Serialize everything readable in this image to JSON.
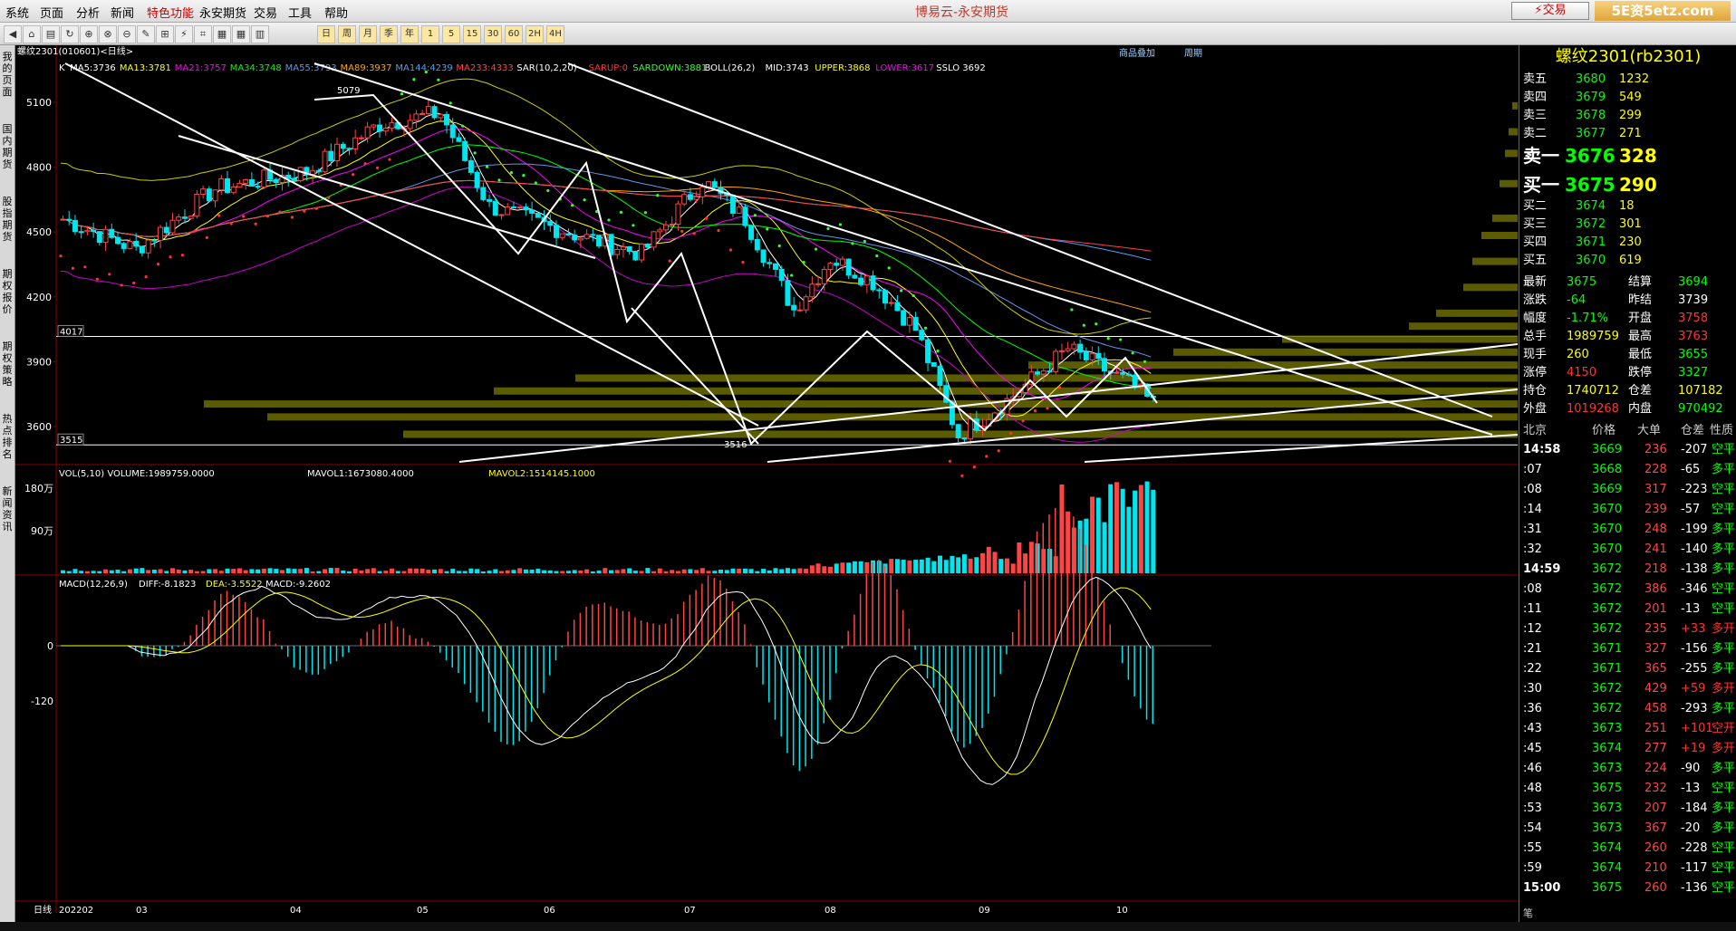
{
  "menu": {
    "items": [
      "系统",
      "页面",
      "分析",
      "新闻",
      "特色功能",
      "永安期货",
      "交易",
      "工具",
      "帮助"
    ],
    "title": "博易云-永安期货",
    "trade": "交易",
    "logo": "5E资5etz.com"
  },
  "toolbar": {
    "buttons": [
      "日",
      "周",
      "月",
      "季",
      "年",
      "1",
      "5",
      "15",
      "30",
      "60",
      "2H",
      "4H"
    ]
  },
  "sidebar": {
    "tabs": [
      "我的页面",
      "国内期货",
      "股指期货",
      "期权报价",
      "期权策略",
      "热点排名",
      "新闻资讯"
    ]
  },
  "chart": {
    "header": "螺纹2301(010601)<日线>",
    "top_links": [
      "商品叠加",
      "周期"
    ],
    "indicators": [
      {
        "t": "K",
        "c": "#ffffff"
      },
      {
        "t": "MA5:3736",
        "c": "#ffffff"
      },
      {
        "t": "MA13:3781",
        "c": "#ffff00"
      },
      {
        "t": "MA21:3757",
        "c": "#ff00ff"
      },
      {
        "t": "MA34:3748",
        "c": "#00ff00"
      },
      {
        "t": "MA55:3793",
        "c": "#6495ed"
      },
      {
        "t": "MA89:3937",
        "c": "#ffa500"
      },
      {
        "t": "MA144:4239",
        "c": "#4f9ef8"
      },
      {
        "t": "MA233:4333",
        "c": "#ff4444"
      },
      {
        "t": "SAR(10,2,20)",
        "c": "#ffffff"
      },
      {
        "t": "SARUP:0",
        "c": "#ff3333"
      },
      {
        "t": "SARDOWN:3881",
        "c": "#33ff33"
      },
      {
        "t": "BOLL(26,2)",
        "c": "#ffffff"
      },
      {
        "t": "MID:3743",
        "c": "#ffffff"
      },
      {
        "t": "UPPER:3868",
        "c": "#ffff00"
      },
      {
        "t": "LOWER:3617",
        "c": "#ff00ff"
      },
      {
        "t": "SSLO 3692",
        "c": "#ffffff"
      }
    ],
    "price_axis": [
      {
        "v": 5100,
        "label": "5100"
      },
      {
        "v": 4800,
        "label": "4800"
      },
      {
        "v": 4500,
        "label": "4500"
      },
      {
        "v": 4200,
        "label": "4200"
      },
      {
        "v": 3900,
        "label": "3900"
      },
      {
        "v": 3600,
        "label": "3600"
      }
    ],
    "hlines": [
      {
        "v": 4017,
        "label": "4017"
      },
      {
        "v": 3515,
        "label": "3515"
      }
    ],
    "peak_label": "5079",
    "low_label": "3516",
    "vol_header": {
      "a": "VOL(5,10) VOLUME:1989759.0000",
      "b": "MAVOL1:1673080.4000",
      "c": "MAVOL2:1514145.1000"
    },
    "vol_axis": [
      "180万",
      "90万"
    ],
    "macd_header": {
      "a": "MACD(12,26,9)",
      "b": "DIFF:-8.1823",
      "c": "DEA:-3.5522",
      "d": "MACD:-9.2602"
    },
    "macd_axis": [
      "0",
      "-120"
    ],
    "date_axis": [
      "日线",
      "202202",
      "03",
      "04",
      "05",
      "06",
      "07",
      "08",
      "09",
      "10"
    ]
  },
  "quote": {
    "title": "螺纹2301(rb2301)",
    "asks": [
      {
        "l": "卖五",
        "p": "3680",
        "v": "1232"
      },
      {
        "l": "卖四",
        "p": "3679",
        "v": "549"
      },
      {
        "l": "卖三",
        "p": "3678",
        "v": "299"
      },
      {
        "l": "卖二",
        "p": "3677",
        "v": "271"
      },
      {
        "l": "卖一",
        "p": "3676",
        "v": "328"
      }
    ],
    "bids": [
      {
        "l": "买一",
        "p": "3675",
        "v": "290"
      },
      {
        "l": "买二",
        "p": "3674",
        "v": "18"
      },
      {
        "l": "买三",
        "p": "3672",
        "v": "301"
      },
      {
        "l": "买四",
        "p": "3671",
        "v": "230"
      },
      {
        "l": "买五",
        "p": "3670",
        "v": "619"
      }
    ],
    "stats": [
      {
        "a": "最新",
        "av": "3675",
        "ac": "#00ff00",
        "b": "结算",
        "bv": "3694",
        "bc": "#00ff00"
      },
      {
        "a": "涨跌",
        "av": "-64",
        "ac": "#00ff00",
        "b": "昨结",
        "bv": "3739",
        "bc": "#ffffff"
      },
      {
        "a": "幅度",
        "av": "-1.71%",
        "ac": "#00ff00",
        "b": "开盘",
        "bv": "3758",
        "bc": "#ff3333"
      },
      {
        "a": "总手",
        "av": "1989759",
        "ac": "#ffff00",
        "b": "最高",
        "bv": "3763",
        "bc": "#ff3333"
      },
      {
        "a": "现手",
        "av": "260",
        "ac": "#ffff00",
        "b": "最低",
        "bv": "3655",
        "bc": "#00ff00"
      },
      {
        "a": "涨停",
        "av": "4150",
        "ac": "#ff3333",
        "b": "跌停",
        "bv": "3327",
        "bc": "#00ff00"
      },
      {
        "a": "持仓",
        "av": "1740712",
        "ac": "#ffff00",
        "b": "仓差",
        "bv": "107182",
        "bc": "#ffff00"
      },
      {
        "a": "外盘",
        "av": "1019268",
        "ac": "#ff3333",
        "b": "内盘",
        "bv": "970492",
        "bc": "#00ff00"
      }
    ],
    "tick_header": {
      "a": "北京",
      "b": "价格",
      "c": "大单",
      "d": "仓差",
      "e": "性质"
    },
    "ticks": [
      {
        "t": "14:58",
        "p": "3669",
        "v": "236",
        "d": "-207",
        "n": "空平",
        "big": true
      },
      {
        "t": ":07",
        "p": "3668",
        "v": "228",
        "d": "-65",
        "n": "多平"
      },
      {
        "t": ":08",
        "p": "3669",
        "v": "317",
        "d": "-223",
        "n": "空平"
      },
      {
        "t": ":14",
        "p": "3670",
        "v": "239",
        "d": "-57",
        "n": "空平"
      },
      {
        "t": ":31",
        "p": "3670",
        "v": "248",
        "d": "-199",
        "n": "多平"
      },
      {
        "t": ":32",
        "p": "3670",
        "v": "241",
        "d": "-140",
        "n": "多平"
      },
      {
        "t": "14:59",
        "p": "3672",
        "v": "218",
        "d": "-138",
        "n": "多平",
        "big": true
      },
      {
        "t": ":08",
        "p": "3672",
        "v": "386",
        "d": "-346",
        "n": "空平"
      },
      {
        "t": ":11",
        "p": "3672",
        "v": "201",
        "d": "-13",
        "n": "空平"
      },
      {
        "t": ":12",
        "p": "3672",
        "v": "235",
        "d": "+33",
        "n": "多开"
      },
      {
        "t": ":21",
        "p": "3671",
        "v": "327",
        "d": "-156",
        "n": "多平"
      },
      {
        "t": ":22",
        "p": "3671",
        "v": "365",
        "d": "-255",
        "n": "多平"
      },
      {
        "t": ":30",
        "p": "3672",
        "v": "429",
        "d": "+59",
        "n": "多开"
      },
      {
        "t": ":36",
        "p": "3672",
        "v": "458",
        "d": "-293",
        "n": "多平"
      },
      {
        "t": ":43",
        "p": "3673",
        "v": "251",
        "d": "+101",
        "n": "空开"
      },
      {
        "t": ":45",
        "p": "3674",
        "v": "277",
        "d": "+19",
        "n": "多开"
      },
      {
        "t": ":46",
        "p": "3673",
        "v": "224",
        "d": "-90",
        "n": "多平"
      },
      {
        "t": ":48",
        "p": "3675",
        "v": "232",
        "d": "-13",
        "n": "空平"
      },
      {
        "t": ":53",
        "p": "3673",
        "v": "207",
        "d": "-184",
        "n": "多平"
      },
      {
        "t": ":54",
        "p": "3673",
        "v": "367",
        "d": "-20",
        "n": "多平"
      },
      {
        "t": ":55",
        "p": "3674",
        "v": "260",
        "d": "-228",
        "n": "空平"
      },
      {
        "t": ":59",
        "p": "3674",
        "v": "210",
        "d": "-117",
        "n": "空平"
      },
      {
        "t": "15:00",
        "p": "3675",
        "v": "260",
        "d": "-136",
        "n": "空平",
        "big": true
      }
    ],
    "bottom_label": "笔"
  }
}
